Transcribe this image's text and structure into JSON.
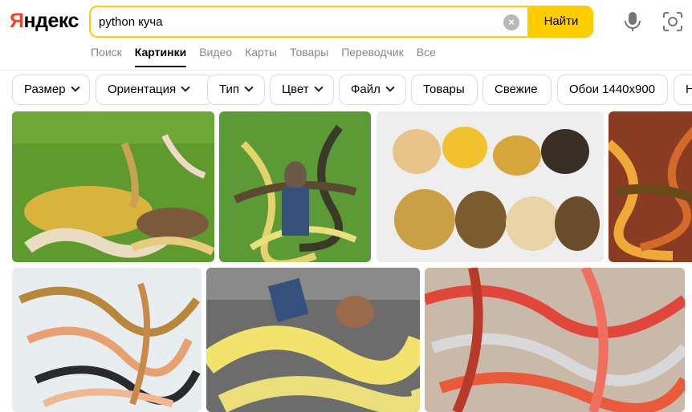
{
  "logo": {
    "first_letter": "Я",
    "rest": "ндекс"
  },
  "search": {
    "query": "python куча",
    "button_label": "Найти"
  },
  "tabs": [
    {
      "label": "Поиск",
      "active": false
    },
    {
      "label": "Картинки",
      "active": true
    },
    {
      "label": "Видео",
      "active": false
    },
    {
      "label": "Карты",
      "active": false
    },
    {
      "label": "Товары",
      "active": false
    },
    {
      "label": "Переводчик",
      "active": false
    },
    {
      "label": "Все",
      "active": false
    }
  ],
  "filters": [
    {
      "label": "Размер",
      "dropdown": true
    },
    {
      "label": "Ориентация",
      "dropdown": true
    },
    {
      "label": "Тип",
      "dropdown": true
    },
    {
      "label": "Цвет",
      "dropdown": true
    },
    {
      "label": "Файл",
      "dropdown": true
    },
    {
      "label": "Товары",
      "dropdown": false
    },
    {
      "label": "Свежие",
      "dropdown": false
    },
    {
      "label": "Обои 1440x900",
      "dropdown": false
    },
    {
      "label": "Н",
      "dropdown": false
    }
  ],
  "colors": {
    "accent": "#ffcc00",
    "logo_red": "#fc3f1d"
  },
  "icons": [
    "microphone-icon",
    "camera-search-icon",
    "clear-icon",
    "chevron-down-icon"
  ]
}
